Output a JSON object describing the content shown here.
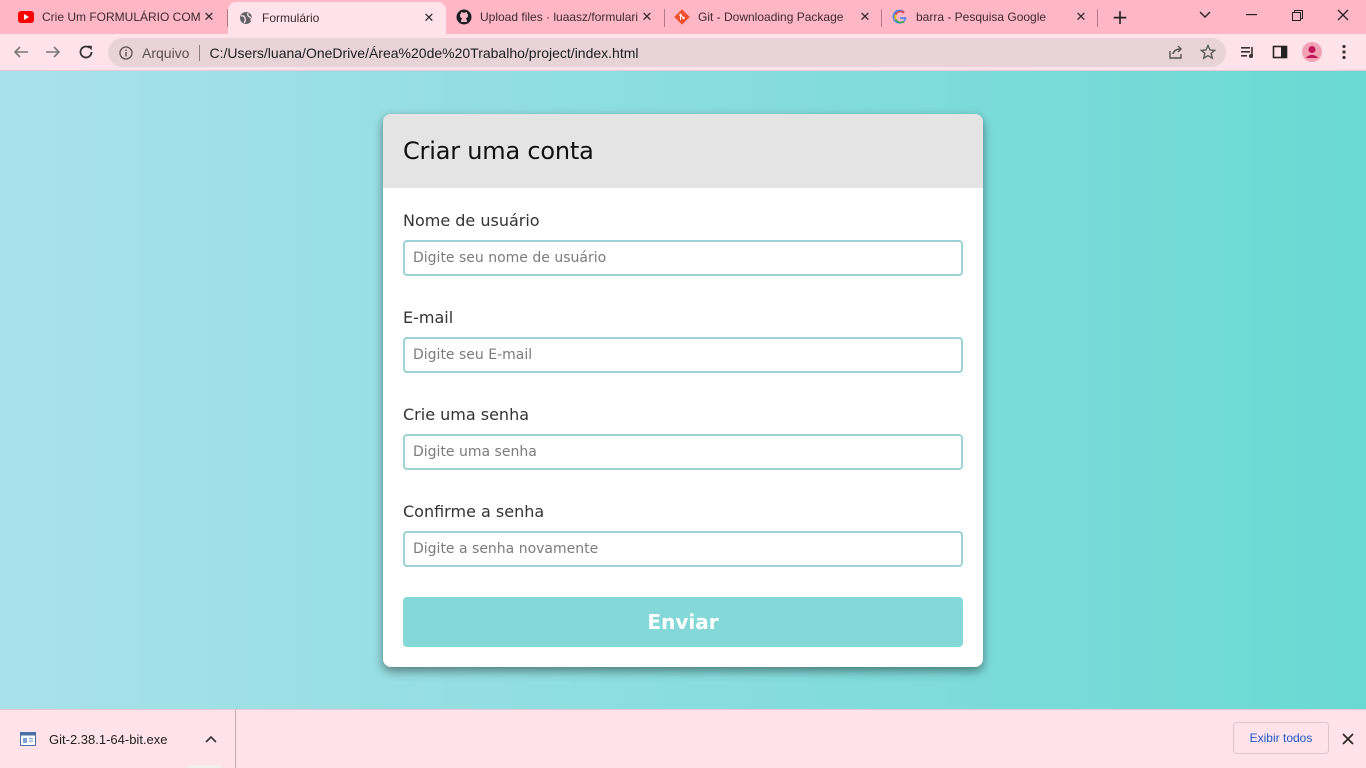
{
  "browser": {
    "tabs": [
      {
        "title": "Crie Um FORMULÁRIO COMPLETO",
        "icon": "youtube-icon",
        "active": false
      },
      {
        "title": "Formulário",
        "icon": "globe-icon",
        "active": true
      },
      {
        "title": "Upload files · luaasz/formulario",
        "icon": "github-icon",
        "active": false
      },
      {
        "title": "Git - Downloading Package",
        "icon": "git-icon",
        "active": false
      },
      {
        "title": "barra - Pesquisa Google",
        "icon": "google-icon",
        "active": false
      }
    ],
    "close_glyph": "✕",
    "new_tab_glyph": "+",
    "address": {
      "scheme_label": "Arquivo",
      "url": "C:/Users/luana/OneDrive/Área%20de%20Trabalho/project/index.html"
    },
    "colors": {
      "tab_strip": "#ffb7c6",
      "toolbar": "#ffe2ea"
    }
  },
  "page": {
    "card_title": "Criar uma conta",
    "fields": [
      {
        "label": "Nome de usuário",
        "placeholder": "Digite seu nome de usuário",
        "value": ""
      },
      {
        "label": "E-mail",
        "placeholder": "Digite seu E-mail",
        "value": ""
      },
      {
        "label": "Crie uma senha",
        "placeholder": "Digite uma senha",
        "value": ""
      },
      {
        "label": "Confirme a senha",
        "placeholder": "Digite a senha novamente",
        "value": ""
      }
    ],
    "submit_label": "Enviar",
    "colors": {
      "gradient_start": "#a9e1ea",
      "gradient_end": "#6ad9d3",
      "button": "#85d8d8",
      "input_border": "#9dd3d6"
    }
  },
  "downloads": {
    "file_name": "Git-2.38.1-64-bit.exe",
    "show_all_label": "Exibir todos"
  }
}
